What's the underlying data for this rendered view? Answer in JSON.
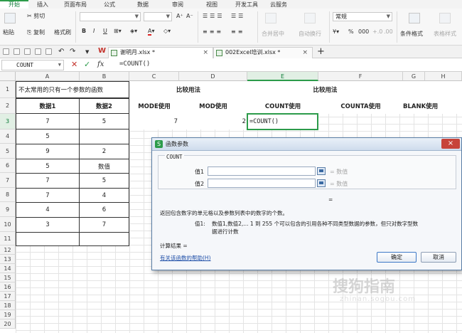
{
  "menu": {
    "tabs": [
      "开始",
      "插入",
      "页面布局",
      "公式",
      "数据",
      "审阅",
      "视图",
      "开发工具",
      "云服务"
    ],
    "active": "开始"
  },
  "ribbon": {
    "paste": "粘贴",
    "cut": "剪切",
    "copy": "复制",
    "format_painter": "格式刷",
    "bold": "B",
    "italic": "I",
    "underline": "U",
    "grow_font": "A⁺",
    "shrink_font": "A⁻",
    "merge_center": "合并居中",
    "wrap_text": "自动换行",
    "number_format": "常规",
    "percent": "%",
    "thousands": "000",
    "cond_format": "条件格式",
    "table_style": "表格样式"
  },
  "doc_tabs": [
    {
      "name": "谢明月.xlsx *",
      "active": true
    },
    {
      "name": "002Excel培训.xlsx *",
      "active": false
    }
  ],
  "new_tab": "+",
  "formula_bar": {
    "name_box": "COUNT",
    "cancel": "✕",
    "confirm": "✓",
    "fx": "fx",
    "formula": "=COUNT()"
  },
  "columns": [
    "A",
    "B",
    "C",
    "D",
    "E",
    "F",
    "G",
    "H"
  ],
  "selected_column": "E",
  "rows": [
    "1",
    "2",
    "3",
    "4",
    "5",
    "6",
    "7",
    "8",
    "9",
    "10",
    "11",
    "12",
    "13",
    "14",
    "15",
    "16",
    "17",
    "18",
    "19",
    "20"
  ],
  "selected_row": "3",
  "sheet": {
    "a1": "不太常用的只有一个参数的函数",
    "c1": "比较用法",
    "e1": "比较用法",
    "a2": "数据1",
    "b2": "数据2",
    "c2": "MODE使用",
    "d2": "MOD使用",
    "e2": "COUNT使用",
    "f2": "COUNTA使用",
    "g2": "BLANK使用",
    "data_a": [
      "7",
      "5",
      "9",
      "5",
      "7",
      "7",
      "4",
      "3"
    ],
    "data_b": [
      "5",
      "",
      "2",
      "数值",
      "5",
      "4",
      "6",
      "7"
    ],
    "c3": "7",
    "d3": "2",
    "e3": "=COUNT()"
  },
  "dialog": {
    "title": "函数参数",
    "close": "×",
    "function_name": "COUNT",
    "arg1_label": "值1",
    "arg2_label": "值2",
    "arg1_value": "= 数值",
    "arg2_value": "= 数值",
    "result_eq": "=",
    "description": "返回包含数字的单元格以及参数列表中的数字的个数。",
    "param_desc_label": "值1:",
    "param_desc_line1": "数值1,数值2,... 1 到 255 个可以包含的引用各种不同类型数据的参数，但只对数字型数",
    "param_desc_line2": "据进行计数",
    "calc_result": "计算结果 =",
    "help_link": "有关该函数的帮助(H)",
    "ok": "确定",
    "cancel": "取消"
  },
  "watermark": {
    "main": "搜狗指南",
    "sub": "zhinan.sogou.com"
  }
}
